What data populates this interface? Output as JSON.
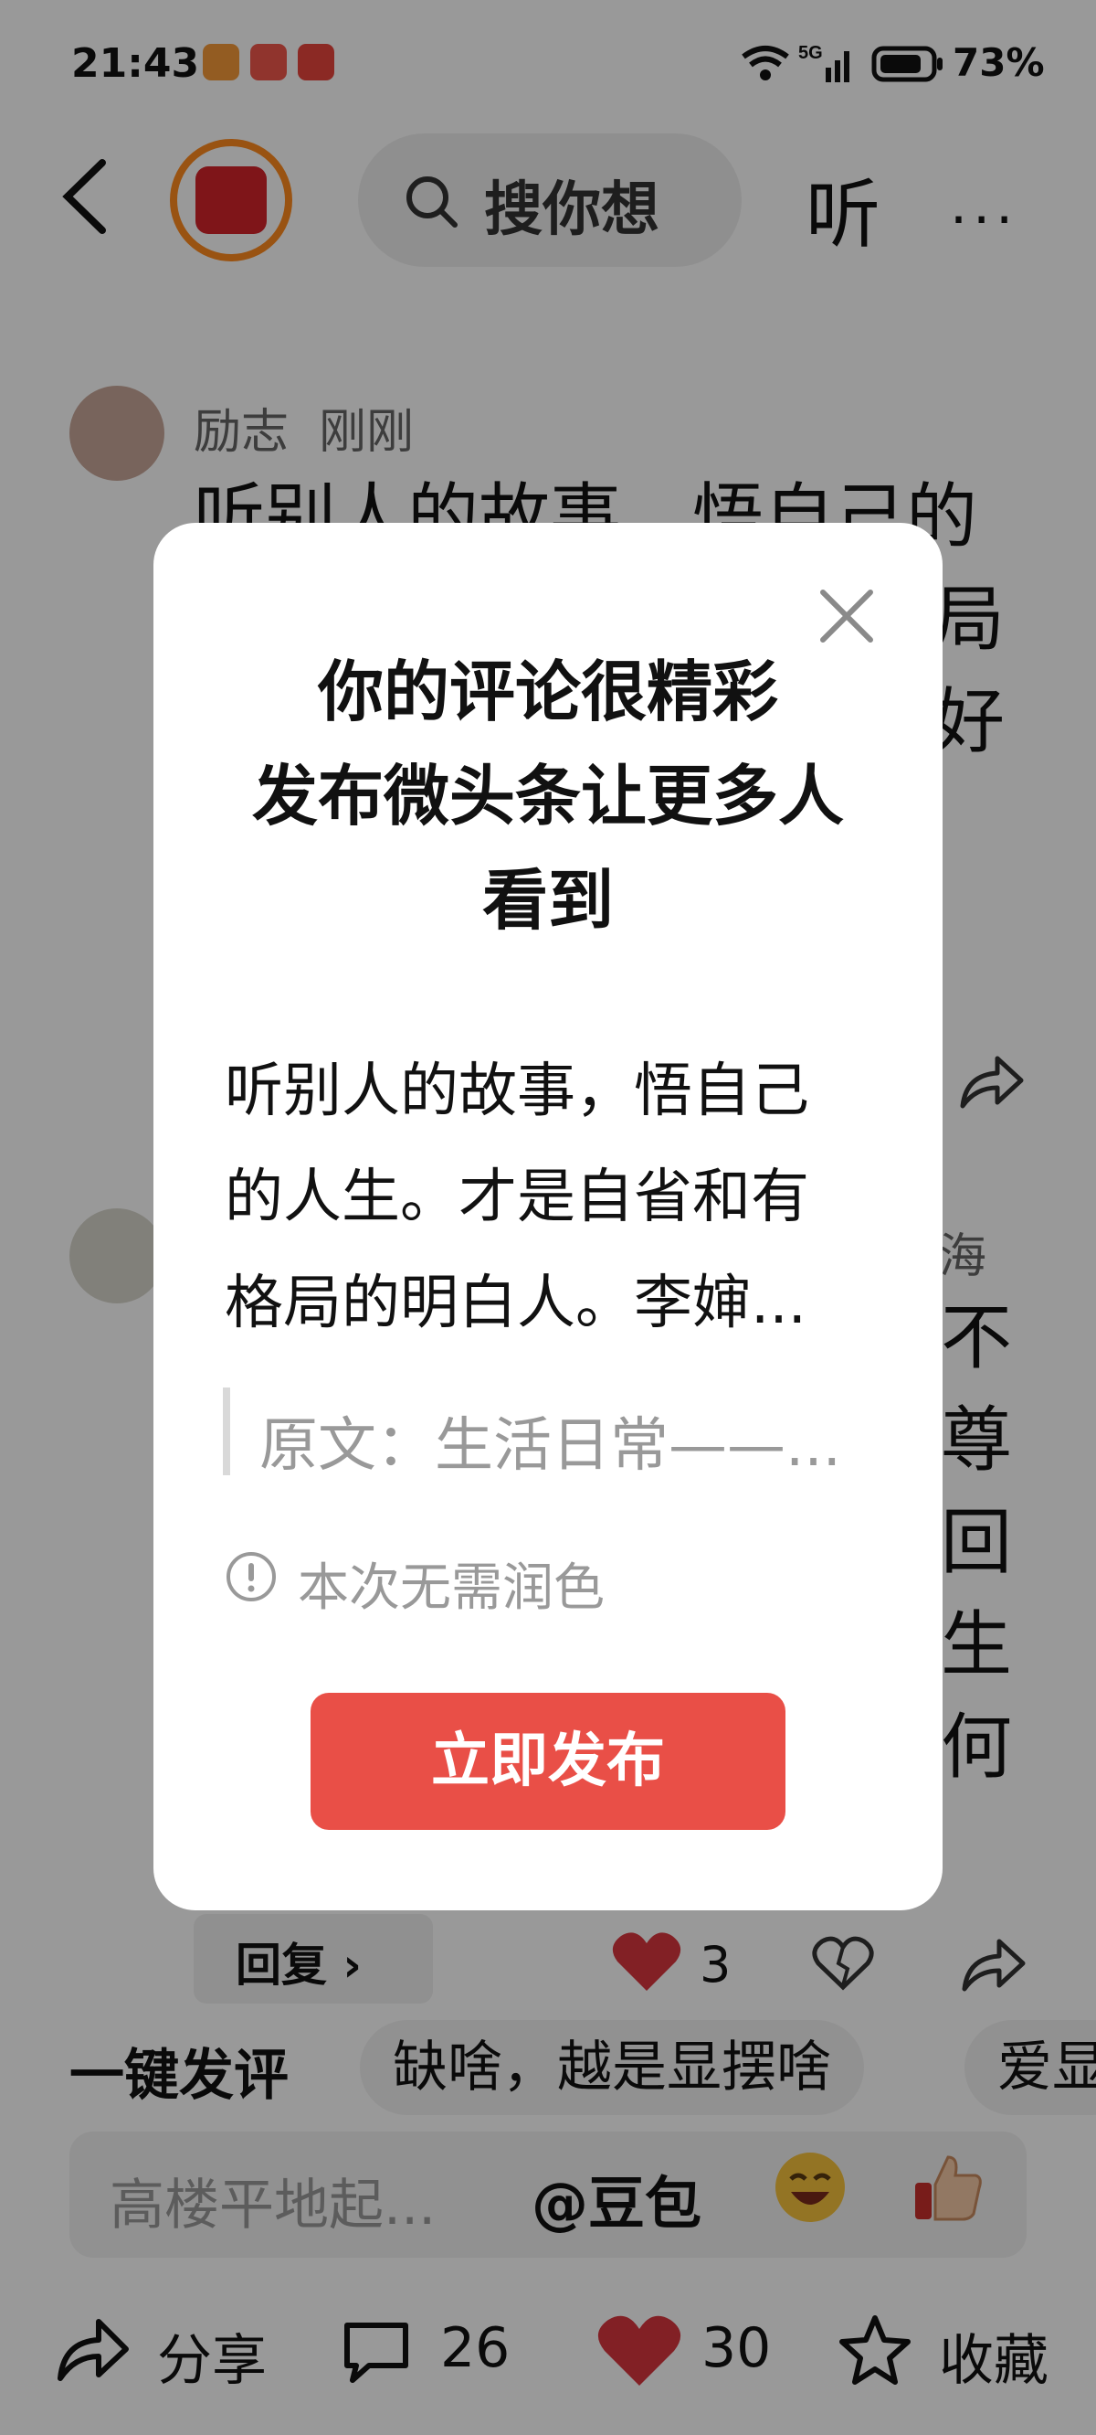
{
  "status_bar": {
    "time": "21:43",
    "battery": "73%"
  },
  "header": {
    "search_placeholder": "搜你想",
    "listen": "听",
    "more": "···"
  },
  "feed": [
    {
      "author_meta": "励志  刚刚",
      "lines": [
        "听别人的故事，悟自己的",
        "局",
        "好"
      ]
    },
    {
      "author_meta": "海",
      "side_chars": [
        "不",
        "尊",
        "回",
        "生",
        "何"
      ]
    }
  ],
  "feed_actions": {
    "reply": "回复 ›",
    "likes": "3"
  },
  "suggestions": {
    "quick": "一键发评",
    "chips": [
      "缺啥，越是显摆啥",
      "爱显"
    ]
  },
  "comment_input": {
    "placeholder": "高楼平地起...",
    "mention": "@豆包"
  },
  "bottom_bar": {
    "share": "分享",
    "comments": "26",
    "likes": "30",
    "favorite": "收藏"
  },
  "dialog": {
    "title_lines": [
      "你的评论很精彩",
      "发布微头条让更多人",
      "看到"
    ],
    "body_lines": [
      "听别人的故事，悟自己",
      "的人生。才是自省和有",
      "格局的明白人。李婶..."
    ],
    "quote": "原文：生活日常——...",
    "notice": "本次无需润色",
    "publish_button": "立即发布"
  },
  "colors": {
    "accent_red": "#e94f47",
    "like_red": "#d9363e"
  }
}
